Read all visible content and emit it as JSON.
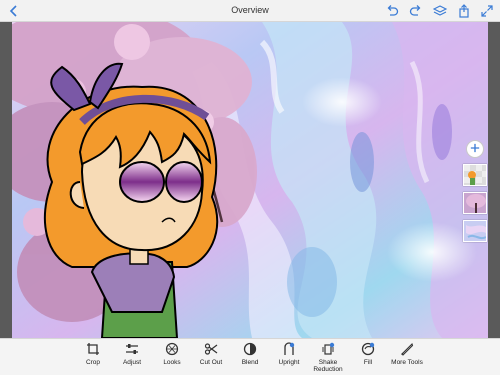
{
  "header": {
    "title": "Overview",
    "icons": [
      "back-icon",
      "undo-icon",
      "redo-icon",
      "layers-icon",
      "share-icon",
      "expand-icon"
    ]
  },
  "layers": {
    "add_icon": "plus-icon",
    "thumbnails": [
      "layer-character",
      "layer-blossom",
      "layer-background"
    ]
  },
  "toolbar": {
    "items": [
      {
        "label": "Crop",
        "icon": "crop-icon"
      },
      {
        "label": "Adjust",
        "icon": "sliders-icon"
      },
      {
        "label": "Looks",
        "icon": "looks-icon"
      },
      {
        "label": "Cut Out",
        "icon": "scissors-icon"
      },
      {
        "label": "Blend",
        "icon": "blend-icon"
      },
      {
        "label": "Upright",
        "icon": "upright-icon"
      },
      {
        "label": "Shake Reduction",
        "icon": "shake-reduction-icon"
      },
      {
        "label": "Fill",
        "icon": "fill-icon"
      },
      {
        "label": "More Tools",
        "icon": "more-tools-icon"
      }
    ]
  },
  "colors": {
    "accent": "#3a7bd5",
    "toolbar_bg": "#f4f4f4",
    "canvas_bg": "#5a5a5a"
  }
}
